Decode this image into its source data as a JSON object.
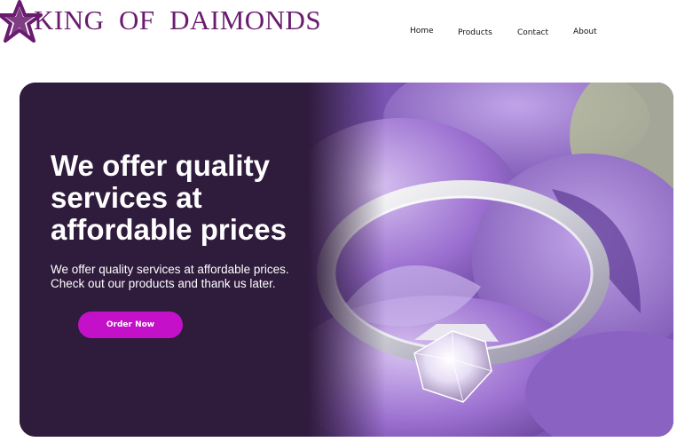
{
  "brand": {
    "name": "KING  OF  DAIMONDS",
    "logo_icon": "star-icon",
    "color": "#6a1b6f"
  },
  "nav": {
    "items": [
      {
        "label": "Home"
      },
      {
        "label": "Products"
      },
      {
        "label": "Contact"
      },
      {
        "label": "About"
      }
    ]
  },
  "hero": {
    "title": "We offer quality services at affordable prices",
    "subtitle": "We offer quality services at affordable prices. Check out our products and thank us later.",
    "cta_label": "Order Now",
    "image_icon": "diamond-ring-on-purple-petals",
    "background_color": "#2f1b3c",
    "cta_color": "#c410c8"
  }
}
